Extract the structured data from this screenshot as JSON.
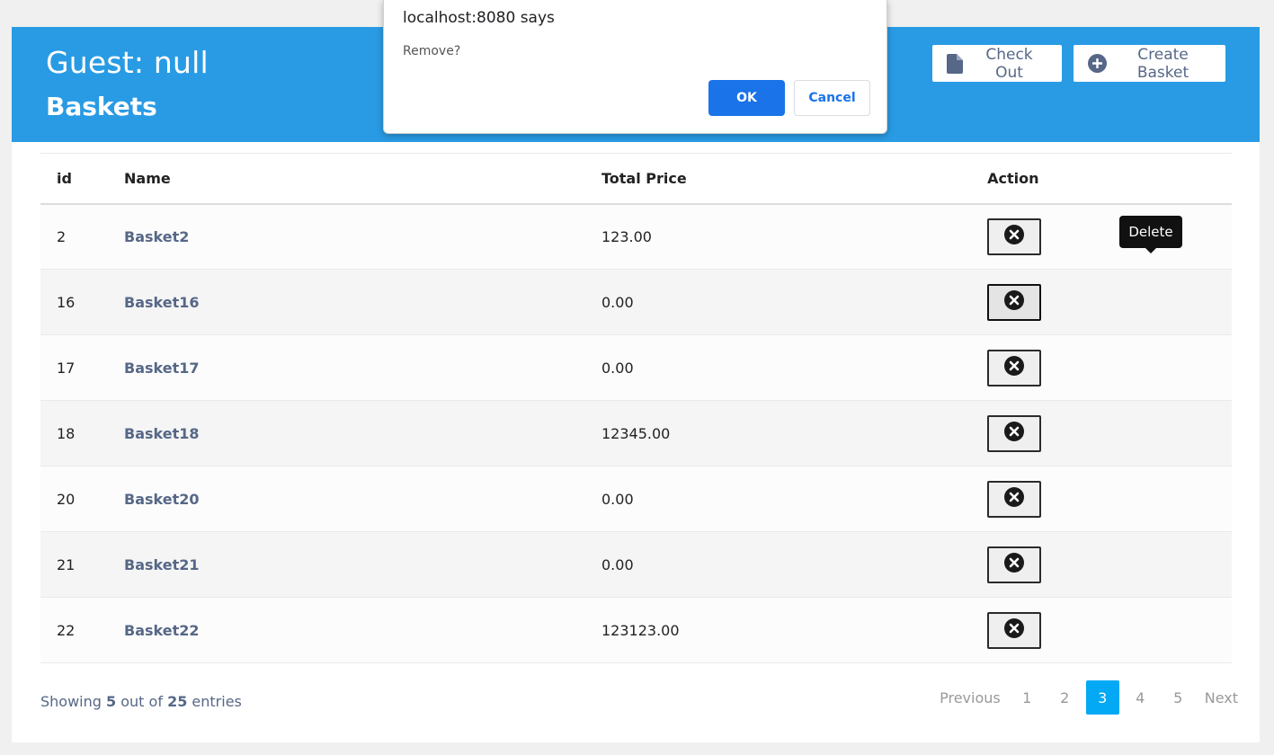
{
  "header": {
    "guest": "Guest: null",
    "title": "Baskets",
    "checkout_label": "Check Out",
    "create_label": "Create Basket"
  },
  "table": {
    "columns": [
      "id",
      "Name",
      "Total Price",
      "Action"
    ],
    "rows": [
      {
        "id": "2",
        "name": "Basket2",
        "price": "123.00"
      },
      {
        "id": "16",
        "name": "Basket16",
        "price": "0.00"
      },
      {
        "id": "17",
        "name": "Basket17",
        "price": "0.00"
      },
      {
        "id": "18",
        "name": "Basket18",
        "price": "12345.00"
      },
      {
        "id": "20",
        "name": "Basket20",
        "price": "0.00"
      },
      {
        "id": "21",
        "name": "Basket21",
        "price": "0.00"
      },
      {
        "id": "22",
        "name": "Basket22",
        "price": "123123.00"
      }
    ]
  },
  "tooltip": "Delete",
  "footer": {
    "showing": "Showing",
    "shown_count": "5",
    "out_of": "out of",
    "total": "25",
    "entries": "entries"
  },
  "pagination": {
    "previous": "Previous",
    "pages": [
      "1",
      "2",
      "3",
      "4",
      "5"
    ],
    "current": "3",
    "next": "Next"
  },
  "dialog": {
    "title": "localhost:8080 says",
    "message": "Remove?",
    "ok": "OK",
    "cancel": "Cancel"
  },
  "colors": {
    "header_bg": "#299be4",
    "link": "#566787",
    "active_page": "#03a9f4",
    "dialog_ok": "#1a73e8"
  }
}
